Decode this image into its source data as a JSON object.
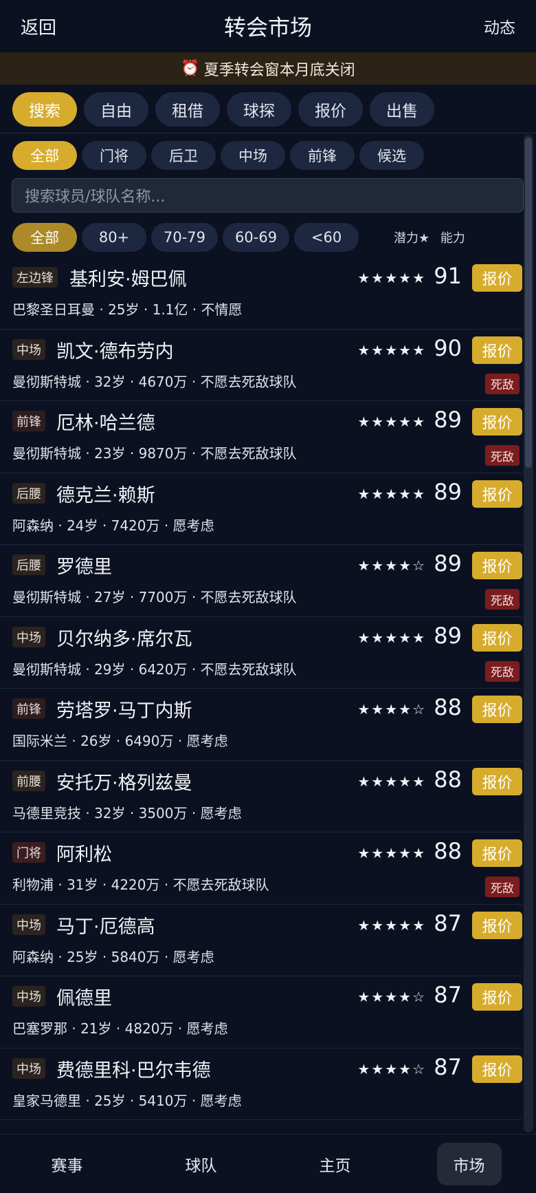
{
  "header": {
    "back": "返回",
    "title": "转会市场",
    "feed": "动态"
  },
  "notice": {
    "icon": "alarm-clock-icon",
    "text": "夏季转会窗本月底关闭"
  },
  "tabs": [
    "搜索",
    "自由",
    "租借",
    "球探",
    "报价",
    "出售"
  ],
  "positions": [
    "全部",
    "门将",
    "后卫",
    "中场",
    "前锋",
    "候选"
  ],
  "search": {
    "placeholder": "搜索球员/球队名称..."
  },
  "ratings": [
    "全部",
    "80+",
    "70-79",
    "60-69",
    "<60"
  ],
  "sort": {
    "potential": "潜力★",
    "ability": "能力"
  },
  "offer_label": "报价",
  "rival_label": "死敌",
  "players": [
    {
      "pos": "左边锋",
      "name": "基利安·姆巴佩",
      "meta": "巴黎圣日耳曼 · 25岁 · 1.1亿 · 不情愿",
      "stars": "★★★★★",
      "ovr": "91",
      "rival": false
    },
    {
      "pos": "中场",
      "name": "凯文·德布劳内",
      "meta": "曼彻斯特城 · 32岁 · 4670万 · 不愿去死敌球队",
      "stars": "★★★★★",
      "ovr": "90",
      "rival": true
    },
    {
      "pos": "前锋",
      "name": "厄林·哈兰德",
      "meta": "曼彻斯特城 · 23岁 · 9870万 · 不愿去死敌球队",
      "stars": "★★★★★",
      "ovr": "89",
      "rival": true
    },
    {
      "pos": "后腰",
      "name": "德克兰·赖斯",
      "meta": "阿森纳 · 24岁 · 7420万 · 愿考虑",
      "stars": "★★★★★",
      "ovr": "89",
      "rival": false
    },
    {
      "pos": "后腰",
      "name": "罗德里",
      "meta": "曼彻斯特城 · 27岁 · 7700万 · 不愿去死敌球队",
      "stars": "★★★★☆",
      "ovr": "89",
      "rival": true
    },
    {
      "pos": "中场",
      "name": "贝尔纳多·席尔瓦",
      "meta": "曼彻斯特城 · 29岁 · 6420万 · 不愿去死敌球队",
      "stars": "★★★★★",
      "ovr": "89",
      "rival": true
    },
    {
      "pos": "前锋",
      "name": "劳塔罗·马丁内斯",
      "meta": "国际米兰 · 26岁 · 6490万 · 愿考虑",
      "stars": "★★★★☆",
      "ovr": "88",
      "rival": false
    },
    {
      "pos": "前腰",
      "name": "安托万·格列兹曼",
      "meta": "马德里竞技 · 32岁 · 3500万 · 愿考虑",
      "stars": "★★★★★",
      "ovr": "88",
      "rival": false
    },
    {
      "pos": "门将",
      "name": "阿利松",
      "meta": "利物浦 · 31岁 · 4220万 · 不愿去死敌球队",
      "stars": "★★★★★",
      "ovr": "88",
      "rival": true
    },
    {
      "pos": "中场",
      "name": "马丁·厄德高",
      "meta": "阿森纳 · 25岁 · 5840万 · 愿考虑",
      "stars": "★★★★★",
      "ovr": "87",
      "rival": false
    },
    {
      "pos": "中场",
      "name": "佩德里",
      "meta": "巴塞罗那 · 21岁 · 4820万 · 愿考虑",
      "stars": "★★★★☆",
      "ovr": "87",
      "rival": false
    },
    {
      "pos": "中场",
      "name": "费德里科·巴尔韦德",
      "meta": "皇家马德里 · 25岁 · 5410万 · 愿考虑",
      "stars": "★★★★☆",
      "ovr": "87",
      "rival": false
    }
  ],
  "bottom_nav": [
    "赛事",
    "球队",
    "主页",
    "市场"
  ]
}
